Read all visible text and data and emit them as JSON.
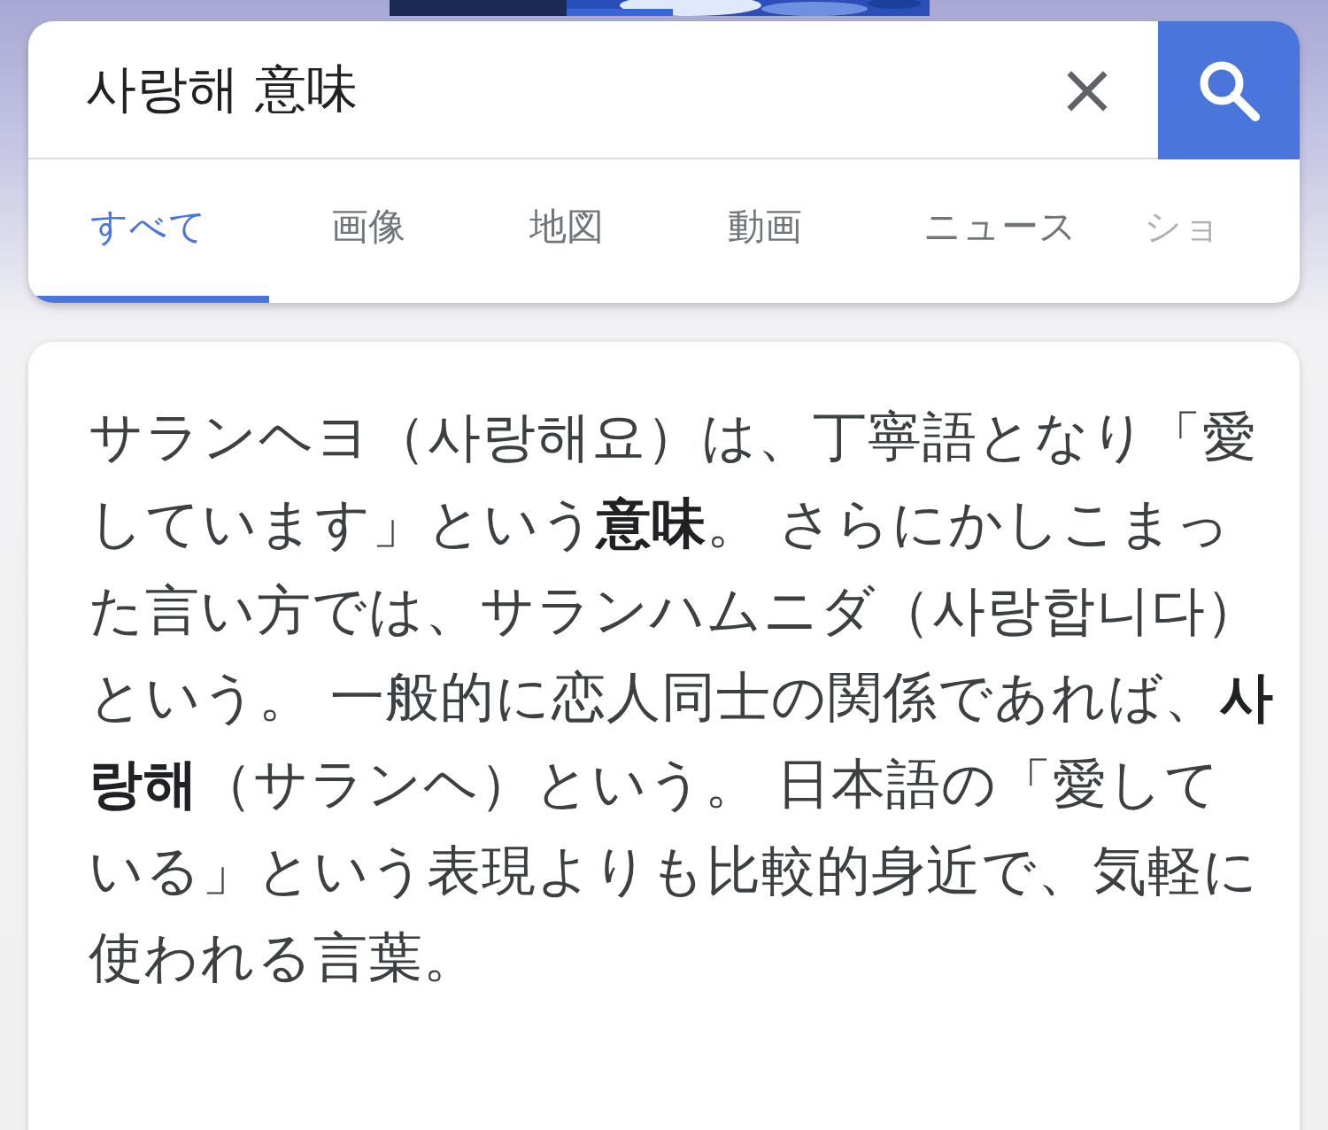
{
  "search": {
    "query": "사랑해 意味",
    "clear_icon": "×"
  },
  "tabs": [
    {
      "label": "すべて",
      "selected": true
    },
    {
      "label": "画像",
      "selected": false
    },
    {
      "label": "地図",
      "selected": false
    },
    {
      "label": "動画",
      "selected": false
    },
    {
      "label": "ニュース",
      "selected": false
    },
    {
      "label": "ショ",
      "selected": false
    }
  ],
  "answer": {
    "text": "サランヘヨ（사랑해요）は、丁寧語となり「愛しています」という**意味**。 さらにかしこまった言い方では、サランハムニダ（사랑합니다）という。 一般的に恋人同士の関係であれば、**사랑해**（サランヘ）という。 日本語の「愛している」という表現よりも比較的身近で、気軽に使われる言葉。"
  }
}
